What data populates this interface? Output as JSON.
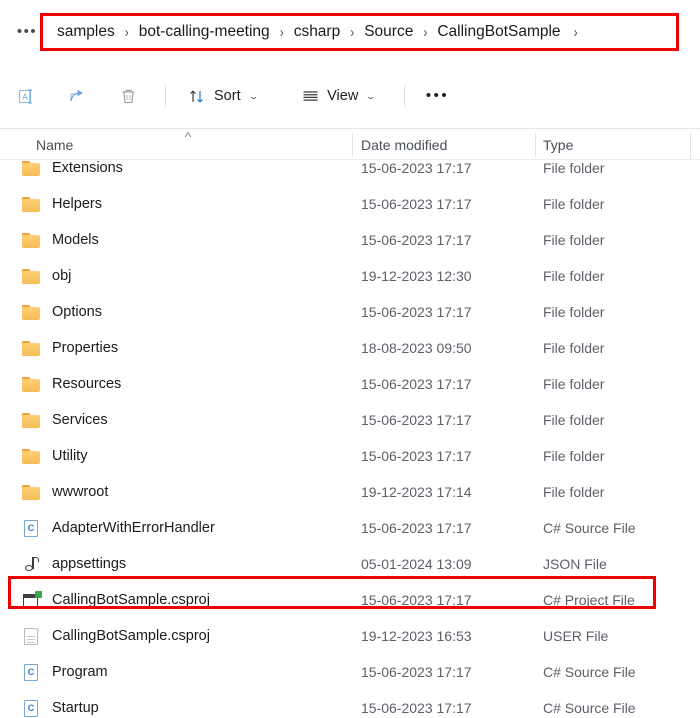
{
  "window": {
    "type": "file-explorer"
  },
  "address_bar": {
    "overflow_label": "•••",
    "crumbs": [
      {
        "label": "samples"
      },
      {
        "label": "bot-calling-meeting"
      },
      {
        "label": "csharp"
      },
      {
        "label": "Source"
      },
      {
        "label": "CallingBotSample"
      }
    ],
    "separator": "›",
    "trailing_separator": "›"
  },
  "command_bar": {
    "rename_icon": "rename-icon",
    "share_icon": "share-icon",
    "delete_icon": "delete-icon",
    "sort_label": "Sort",
    "sort_icon": "sort-arrows-icon",
    "view_label": "View",
    "view_icon": "view-list-icon",
    "more_label": "•••",
    "chevron": "⌄"
  },
  "columns": {
    "name": "Name",
    "date_modified": "Date modified",
    "type": "Type",
    "sort_indicator": "˄"
  },
  "files": [
    {
      "name": "Extensions",
      "date": "15-06-2023 17:17",
      "type": "File folder",
      "icon": "folder-icon",
      "clipped": true,
      "highlighted": false
    },
    {
      "name": "Helpers",
      "date": "15-06-2023 17:17",
      "type": "File folder",
      "icon": "folder-icon",
      "clipped": false,
      "highlighted": false
    },
    {
      "name": "Models",
      "date": "15-06-2023 17:17",
      "type": "File folder",
      "icon": "folder-icon",
      "clipped": false,
      "highlighted": false
    },
    {
      "name": "obj",
      "date": "19-12-2023 12:30",
      "type": "File folder",
      "icon": "folder-icon",
      "clipped": false,
      "highlighted": false
    },
    {
      "name": "Options",
      "date": "15-06-2023 17:17",
      "type": "File folder",
      "icon": "folder-icon",
      "clipped": false,
      "highlighted": false
    },
    {
      "name": "Properties",
      "date": "18-08-2023 09:50",
      "type": "File folder",
      "icon": "folder-icon",
      "clipped": false,
      "highlighted": false
    },
    {
      "name": "Resources",
      "date": "15-06-2023 17:17",
      "type": "File folder",
      "icon": "folder-icon",
      "clipped": false,
      "highlighted": false
    },
    {
      "name": "Services",
      "date": "15-06-2023 17:17",
      "type": "File folder",
      "icon": "folder-icon",
      "clipped": false,
      "highlighted": false
    },
    {
      "name": "Utility",
      "date": "15-06-2023 17:17",
      "type": "File folder",
      "icon": "folder-icon",
      "clipped": false,
      "highlighted": false
    },
    {
      "name": "wwwroot",
      "date": "19-12-2023 17:14",
      "type": "File folder",
      "icon": "folder-icon",
      "clipped": false,
      "highlighted": false
    },
    {
      "name": "AdapterWithErrorHandler",
      "date": "15-06-2023 17:17",
      "type": "C# Source File",
      "icon": "csharp-file-icon",
      "clipped": false,
      "highlighted": false
    },
    {
      "name": "appsettings",
      "date": "05-01-2024 13:09",
      "type": "JSON File",
      "icon": "json-file-icon",
      "clipped": false,
      "highlighted": false
    },
    {
      "name": "CallingBotSample.csproj",
      "date": "15-06-2023 17:17",
      "type": "C# Project File",
      "icon": "csproj-file-icon",
      "clipped": false,
      "highlighted": true
    },
    {
      "name": "CallingBotSample.csproj",
      "date": "19-12-2023 16:53",
      "type": "USER File",
      "icon": "generic-file-icon",
      "clipped": false,
      "highlighted": false
    },
    {
      "name": "Program",
      "date": "15-06-2023 17:17",
      "type": "C# Source File",
      "icon": "csharp-file-icon",
      "clipped": false,
      "highlighted": false
    },
    {
      "name": "Startup",
      "date": "15-06-2023 17:17",
      "type": "C# Source File",
      "icon": "csharp-file-icon",
      "clipped": false,
      "highlighted": false
    }
  ],
  "annotations": {
    "color": "#ee0000",
    "breadcrumb_box": "highlight-breadcrumb-path",
    "row_box": "highlight-csproj-row"
  },
  "csharp_glyph": "C"
}
